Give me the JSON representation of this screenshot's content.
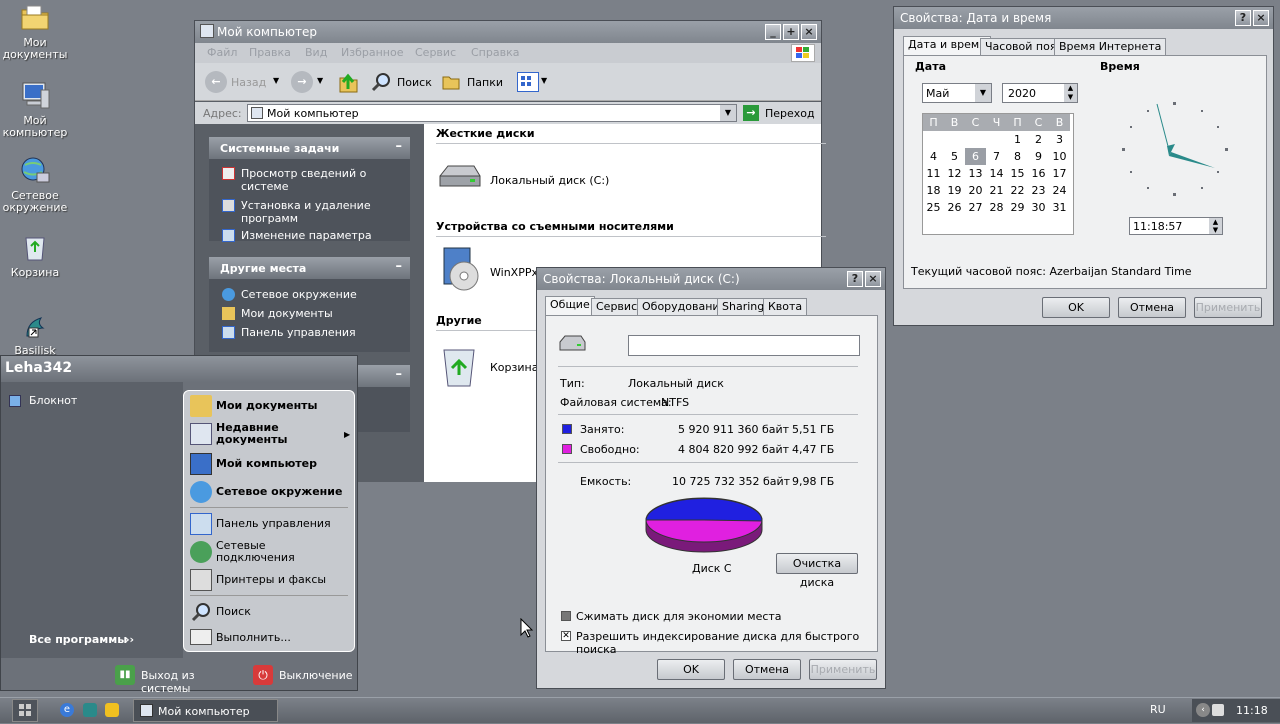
{
  "desktop": {
    "icons": [
      {
        "label": "Мои документы",
        "label2": ""
      },
      {
        "label": "Мой компьютер"
      },
      {
        "label": "Сетевое окружение"
      },
      {
        "label": "Корзина"
      },
      {
        "label": "Basilisk"
      }
    ]
  },
  "explorer": {
    "title": "Мой компьютер",
    "menu": [
      "Файл",
      "Правка",
      "Вид",
      "Избранное",
      "Сервис",
      "Справка"
    ],
    "toolbar": {
      "back": "Назад",
      "search": "Поиск",
      "folders": "Папки"
    },
    "address_label": "Адрес:",
    "address_value": "Мой компьютер",
    "go_label": "Переход",
    "tasks": {
      "title": "Системные задачи",
      "items": [
        "Просмотр сведений о системе",
        "Установка и удаление программ",
        "Изменение параметра"
      ]
    },
    "places": {
      "title": "Другие места",
      "items": [
        "Сетевое окружение",
        "Мои документы",
        "Панель управления"
      ]
    },
    "groups": {
      "hdd": "Жесткие диски",
      "removable": "Устройства со съемными носителями",
      "other": "Другие"
    },
    "items": {
      "local_disk": "Локальный диск (C:)",
      "cd": "WinXPPx",
      "recycle": "Корзина"
    }
  },
  "disk_props": {
    "title": "Свойства: Локальный диск (C:)",
    "tabs": [
      "Общие",
      "Сервис",
      "Оборудование",
      "Sharing",
      "Квота"
    ],
    "name_value": "",
    "type_label": "Тип:",
    "type_value": "Локальный диск",
    "fs_label": "Файловая система:",
    "fs_value": "NTFS",
    "used_label": "Занято:",
    "used_bytes": "5 920 911 360 байт",
    "used_gb": "5,51 ГБ",
    "free_label": "Свободно:",
    "free_bytes": "4 804 820 992 байт",
    "free_gb": "4,47 ГБ",
    "cap_label": "Емкость:",
    "cap_bytes": "10 725 732 352 байт",
    "cap_gb": "9,98 ГБ",
    "disk_label": "Диск C",
    "cleanup": "Очистка диска",
    "compress": "Сжимать диск для экономии места",
    "index": "Разрешить индексирование диска для быстрого поиска",
    "ok": "OK",
    "cancel": "Отмена",
    "apply": "Применить",
    "colors": {
      "used": "#2020e0",
      "free": "#e020e0"
    }
  },
  "datetime": {
    "title": "Свойства: Дата и время",
    "tabs": [
      "Дата и время",
      "Часовой пояс",
      "Время Интернета"
    ],
    "date_label": "Дата",
    "time_label": "Время",
    "month": "Май",
    "year": "2020",
    "weekdays": [
      "П",
      "В",
      "С",
      "Ч",
      "П",
      "С",
      "В"
    ],
    "weeks": [
      [
        "",
        "",
        "",
        "",
        "1",
        "2",
        "3"
      ],
      [
        "4",
        "5",
        "6",
        "7",
        "8",
        "9",
        "10"
      ],
      [
        "11",
        "12",
        "13",
        "14",
        "15",
        "16",
        "17"
      ],
      [
        "18",
        "19",
        "20",
        "21",
        "22",
        "23",
        "24"
      ],
      [
        "25",
        "26",
        "27",
        "28",
        "29",
        "30",
        "31"
      ]
    ],
    "selected_day": "6",
    "time_value": "11:18:57",
    "timezone": "Текущий часовой пояс: Azerbaijan Standard Time",
    "ok": "OK",
    "cancel": "Отмена",
    "apply": "Применить"
  },
  "start_menu": {
    "user": "Leha342",
    "left_items": [
      "Блокнот"
    ],
    "all_programs": "Все программы",
    "right_items": [
      {
        "label": "Мои документы",
        "bold": true
      },
      {
        "label": "Недавние документы",
        "bold": true
      },
      {
        "label": "Мой компьютер",
        "bold": true
      },
      {
        "label": "Сетевое окружение",
        "bold": true
      },
      {
        "label": "Панель управления",
        "bold": false
      },
      {
        "label": "Сетевые подключения",
        "bold": false
      },
      {
        "label": "Принтеры и факсы",
        "bold": false
      },
      {
        "label": "Поиск",
        "bold": false
      },
      {
        "label": "Выполнить...",
        "bold": false
      }
    ],
    "logoff": "Выход из системы",
    "shutdown": "Выключение"
  },
  "taskbar": {
    "task": "Мой компьютер",
    "lang": "RU",
    "clock": "11:18"
  }
}
